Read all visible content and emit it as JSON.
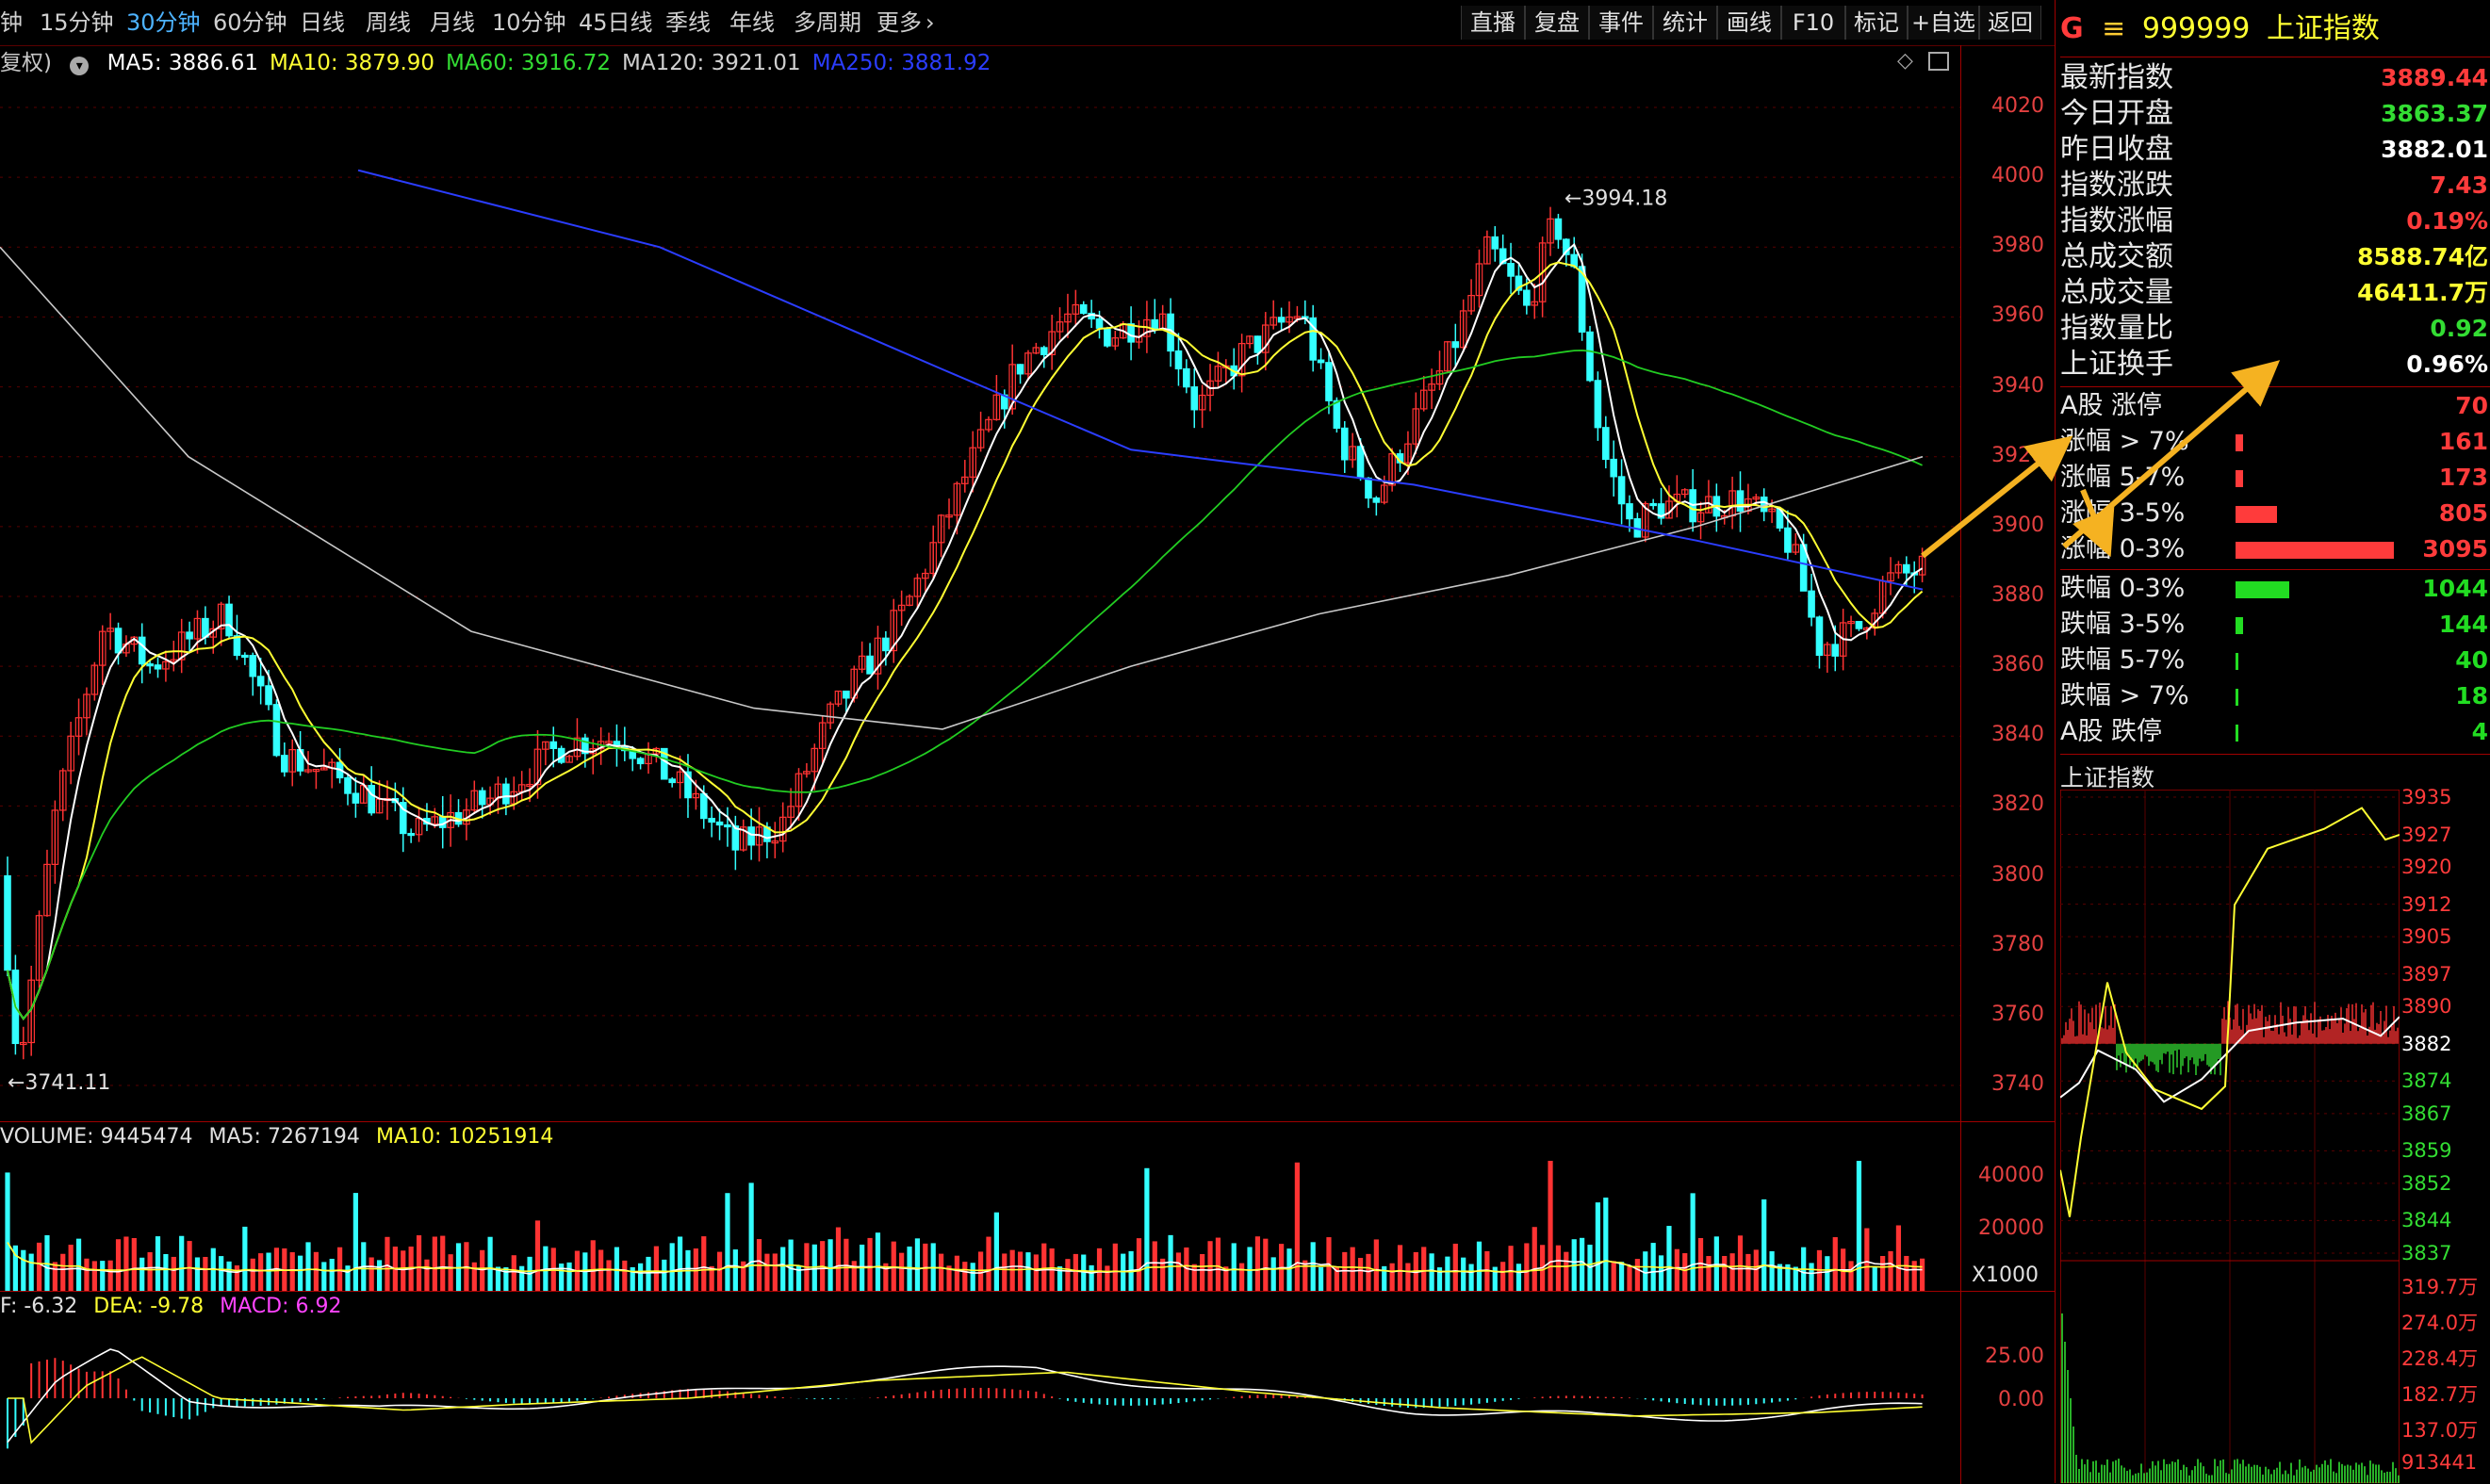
{
  "toolbar": {
    "periods": [
      "钟",
      "15分钟",
      "30分钟",
      "60分钟",
      "日线",
      "周线",
      "月线",
      "10分钟",
      "45日线",
      "季线",
      "年线",
      "多周期",
      "更多"
    ],
    "active_period": "30分钟",
    "tools": [
      "直播",
      "复盘",
      "事件",
      "统计",
      "画线",
      "F10",
      "标记",
      "+自选",
      "返回"
    ]
  },
  "main_chart": {
    "ma_prefix": "复权)",
    "ma": [
      {
        "label": "MA5: 3886.61",
        "color": "#ffffff"
      },
      {
        "label": "MA10: 3879.90",
        "color": "#ffff33"
      },
      {
        "label": "MA60: 3916.72",
        "color": "#33dd33"
      },
      {
        "label": "MA120: 3921.01",
        "color": "#d0d0d0"
      },
      {
        "label": "MA250: 3881.92",
        "color": "#2b3dff"
      }
    ],
    "y_ticks": [
      "4020",
      "4000",
      "3980",
      "3960",
      "3940",
      "3920",
      "3900",
      "3880",
      "3860",
      "3840",
      "3820",
      "3800",
      "3780",
      "3760",
      "3740"
    ],
    "high_label": "3994.18",
    "low_label": "3741.11"
  },
  "volume_panel": {
    "label_volume": "VOLUME: 9445474",
    "label_ma5": "MA5: 7267194",
    "label_ma10": "MA10: 10251914",
    "y_ticks": [
      "40000",
      "20000"
    ],
    "multiplier": "X1000"
  },
  "macd_panel": {
    "label_dif": "F: -6.32",
    "label_dea": "DEA: -9.78",
    "label_macd": "MACD: 6.92",
    "y_ticks": [
      "25.00",
      "0.00"
    ]
  },
  "right_panel": {
    "prefix": "G",
    "menu_glyph": "≡",
    "code": "999999",
    "name": "上证指数",
    "quotes": [
      {
        "label": "最新指数",
        "value": "3889.44",
        "color": "#ff3b3b"
      },
      {
        "label": "今日开盘",
        "value": "3863.37",
        "color": "#33dd33"
      },
      {
        "label": "昨日收盘",
        "value": "3882.01",
        "color": "#ffffff"
      },
      {
        "label": "指数涨跌",
        "value": "7.43",
        "color": "#ff3b3b"
      },
      {
        "label": "指数涨幅",
        "value": "0.19%",
        "color": "#ff3b3b"
      },
      {
        "label": "总成交额",
        "value": "8588.74亿",
        "color": "#ffff33"
      },
      {
        "label": "总成交量",
        "value": "46411.7万",
        "color": "#ffff33"
      },
      {
        "label": "指数量比",
        "value": "0.92",
        "color": "#33dd33"
      },
      {
        "label": "上证换手",
        "value": "0.96%",
        "color": "#ffffff"
      }
    ],
    "breadth_up": [
      {
        "label": "A股 涨停",
        "value": "70",
        "color": "#ff3b3b",
        "share": 0
      },
      {
        "label": "涨幅 > 7%",
        "value": "161",
        "color": "#ff3b3b",
        "share": 0.05
      },
      {
        "label": "涨幅 5-7%",
        "value": "173",
        "color": "#ff3b3b",
        "share": 0.05
      },
      {
        "label": "涨幅 3-5%",
        "value": "805",
        "color": "#ff3b3b",
        "share": 0.26
      },
      {
        "label": "涨幅 0-3%",
        "value": "3095",
        "color": "#ff3b3b",
        "share": 1.0
      }
    ],
    "breadth_down": [
      {
        "label": "跌幅 0-3%",
        "value": "1044",
        "color": "#22dd22",
        "share": 0.34
      },
      {
        "label": "跌幅 3-5%",
        "value": "144",
        "color": "#22dd22",
        "share": 0.05
      },
      {
        "label": "跌幅 5-7%",
        "value": "40",
        "color": "#22dd22",
        "share": 0.01
      },
      {
        "label": "跌幅 > 7%",
        "value": "18",
        "color": "#22dd22",
        "share": 0.01
      },
      {
        "label": "A股 跌停",
        "value": "4",
        "color": "#22dd22",
        "share": 0.01
      }
    ],
    "mini_title": "上证指数",
    "mini_y_ticks": [
      "3935",
      "3927",
      "3920",
      "3912",
      "3905",
      "3897",
      "3890",
      "3882",
      "3874",
      "3867",
      "3859",
      "3852",
      "3844",
      "3837"
    ],
    "mini_vol_ticks": [
      "319.7万",
      "274.0万",
      "228.4万",
      "182.7万",
      "137.0万",
      "913441"
    ]
  }
}
